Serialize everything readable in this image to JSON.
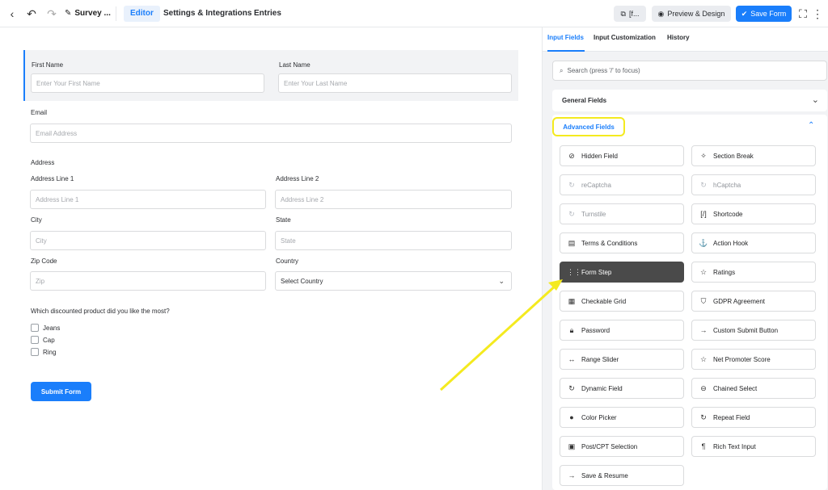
{
  "topbar": {
    "form_title": "Survey ...",
    "tabs": [
      "Editor",
      "Settings & Integrations",
      "Entries"
    ],
    "shortcode_label": "[f...",
    "preview_label": "Preview & Design",
    "save_label": "Save Form"
  },
  "form": {
    "first_name": {
      "label": "First Name",
      "placeholder": "Enter Your First Name"
    },
    "last_name": {
      "label": "Last Name",
      "placeholder": "Enter Your Last Name"
    },
    "email": {
      "label": "Email",
      "placeholder": "Email Address"
    },
    "address": {
      "label": "Address",
      "line1": {
        "label": "Address Line 1",
        "placeholder": "Address Line 1"
      },
      "line2": {
        "label": "Address Line 2",
        "placeholder": "Address Line 2"
      },
      "city": {
        "label": "City",
        "placeholder": "City"
      },
      "state": {
        "label": "State",
        "placeholder": "State"
      },
      "zip": {
        "label": "Zip Code",
        "placeholder": "Zip"
      },
      "country": {
        "label": "Country",
        "value": "Select Country"
      }
    },
    "question": "Which discounted product did you like the most?",
    "options": [
      "Jeans",
      "Cap",
      "Ring"
    ],
    "submit_label": "Submit Form"
  },
  "sidebar": {
    "tabs": [
      "Input Fields",
      "Input Customization",
      "History"
    ],
    "search_placeholder": "Search (press '/' to focus)",
    "general_fields": "General Fields",
    "advanced_fields": "Advanced Fields",
    "fields": [
      {
        "label": "Hidden Field",
        "icon": "eye-slash-icon"
      },
      {
        "label": "Section Break",
        "icon": "puzzle-icon"
      },
      {
        "label": "reCaptcha",
        "icon": "recaptcha-icon"
      },
      {
        "label": "hCaptcha",
        "icon": "hcaptcha-icon"
      },
      {
        "label": "Turnstile",
        "icon": "turnstile-icon"
      },
      {
        "label": "Shortcode",
        "icon": "shortcode-icon"
      },
      {
        "label": "Terms & Conditions",
        "icon": "document-icon"
      },
      {
        "label": "Action Hook",
        "icon": "hook-icon"
      },
      {
        "label": "Form Step",
        "icon": "form-step-icon"
      },
      {
        "label": "Ratings",
        "icon": "star-icon"
      },
      {
        "label": "Checkable Grid",
        "icon": "grid-icon"
      },
      {
        "label": "GDPR Agreement",
        "icon": "shield-icon"
      },
      {
        "label": "Password",
        "icon": "lock-icon"
      },
      {
        "label": "Custom Submit Button",
        "icon": "arrow-right-icon"
      },
      {
        "label": "Range Slider",
        "icon": "slider-icon"
      },
      {
        "label": "Net Promoter Score",
        "icon": "star-outline-icon"
      },
      {
        "label": "Dynamic Field",
        "icon": "refresh-icon"
      },
      {
        "label": "Chained Select",
        "icon": "link-icon"
      },
      {
        "label": "Color Picker",
        "icon": "drop-icon"
      },
      {
        "label": "Repeat Field",
        "icon": "repeat-icon"
      },
      {
        "label": "Post/CPT Selection",
        "icon": "post-icon"
      },
      {
        "label": "Rich Text Input",
        "icon": "rich-text-icon"
      },
      {
        "label": "Save & Resume",
        "icon": "arrow-right-icon"
      }
    ]
  },
  "colors": {
    "accent": "#1a7efb",
    "highlight": "#f4ea1f",
    "active_field": "#4a4a4a"
  }
}
